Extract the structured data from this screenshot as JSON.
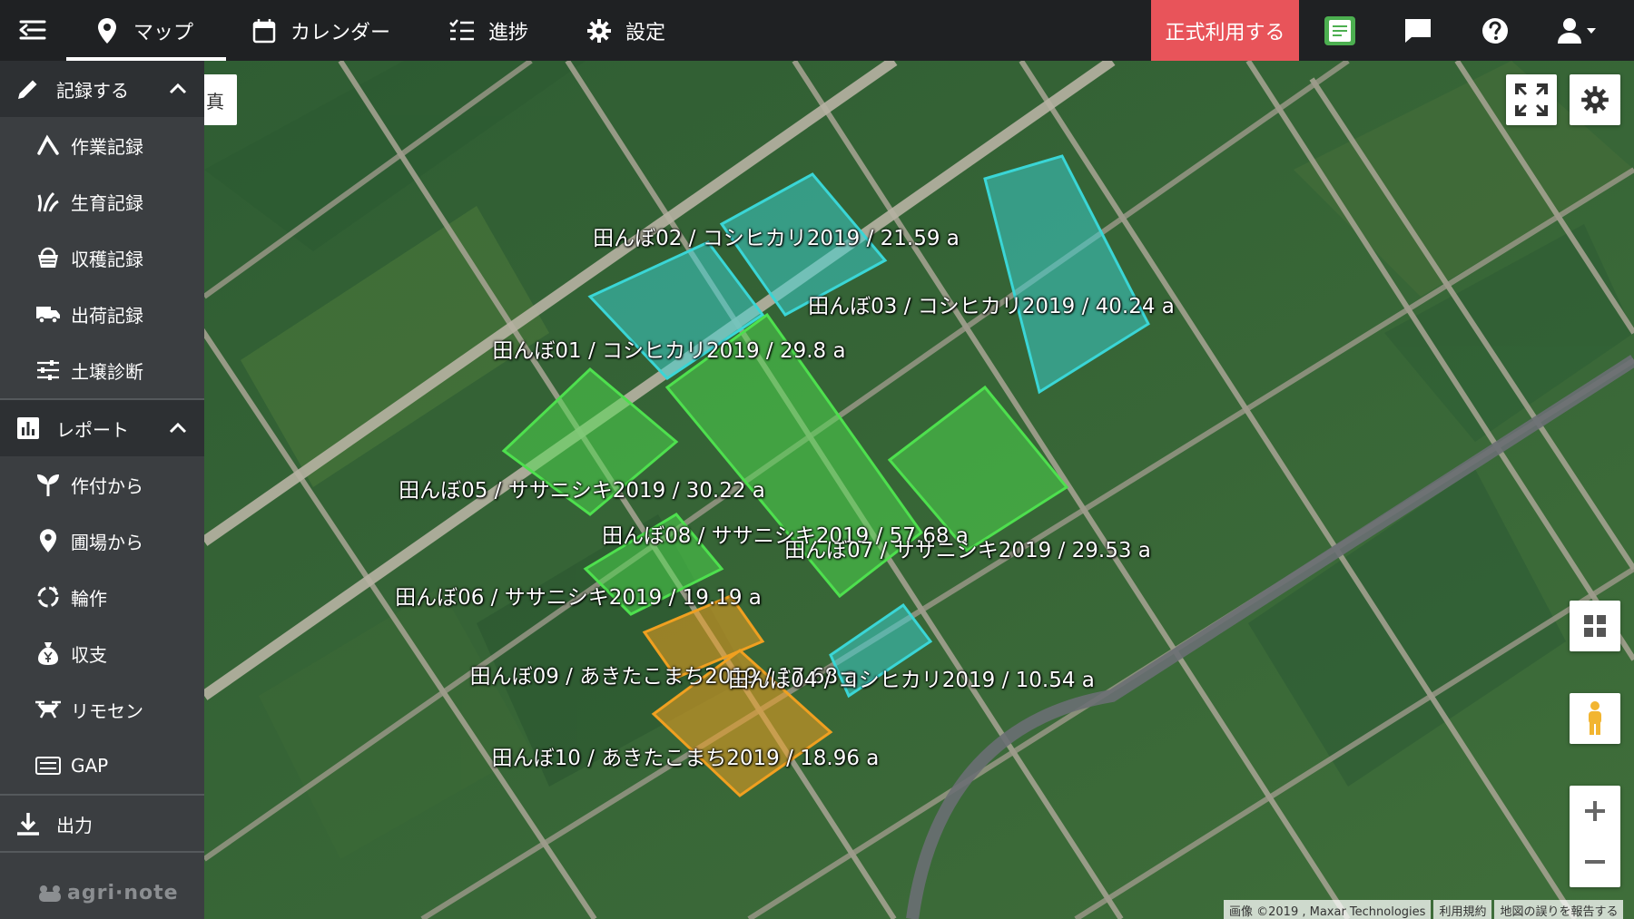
{
  "nav": {
    "tabs": [
      {
        "label": "マップ",
        "icon": "map-pin-icon"
      },
      {
        "label": "カレンダー",
        "icon": "calendar-icon"
      },
      {
        "label": "進捗",
        "icon": "checklist-icon"
      },
      {
        "label": "設定",
        "icon": "gear-icon"
      }
    ],
    "cta_label": "正式利用する",
    "icons": [
      "book-icon",
      "chat-icon",
      "help-icon",
      "user-icon"
    ]
  },
  "sidebar": {
    "record": {
      "title": "記録する",
      "items": [
        {
          "label": "作業記録",
          "icon": "work-record-icon"
        },
        {
          "label": "生育記録",
          "icon": "growth-record-icon"
        },
        {
          "label": "収穫記録",
          "icon": "harvest-basket-icon"
        },
        {
          "label": "出荷記録",
          "icon": "truck-icon"
        },
        {
          "label": "土壌診断",
          "icon": "sliders-icon"
        }
      ]
    },
    "report": {
      "title": "レポート",
      "items": [
        {
          "label": "作付から",
          "icon": "sprout-icon"
        },
        {
          "label": "圃場から",
          "icon": "map-pin-icon"
        },
        {
          "label": "輪作",
          "icon": "rotation-icon"
        },
        {
          "label": "収支",
          "icon": "money-bag-icon"
        },
        {
          "label": "リモセン",
          "icon": "drone-icon"
        },
        {
          "label": "GAP",
          "icon": "gap-icon"
        }
      ]
    },
    "export_label": "出力",
    "brand": "agri·note"
  },
  "map": {
    "search_stub": "真",
    "fields": [
      {
        "label": "田んぼ02  /  コシヒカリ2019  /  21.59 a",
        "color": "#3ad6d6"
      },
      {
        "label": "田んぼ03  /  コシヒカリ2019  /  40.24 a",
        "color": "#3ad6d6"
      },
      {
        "label": "田んぼ01  /  コシヒカリ2019  /  29.8 a",
        "color": "#3ad6d6"
      },
      {
        "label": "田んぼ05  /  ササニシキ2019  /  30.22 a",
        "color": "#4ee04e"
      },
      {
        "label": "田んぼ08  /  ササニシキ2019  /  57.68 a",
        "color": "#4ee04e"
      },
      {
        "label": "田んぼ07  /  ササニシキ2019  /  29.53 a",
        "color": "#4ee04e"
      },
      {
        "label": "田んぼ06  /  ササニシキ2019  /  19.19 a",
        "color": "#4ee04e"
      },
      {
        "label": "田んぼ09  /  あきたこまち2019  /  17.68 a",
        "color": "#f0a020"
      },
      {
        "label": "田んぼ04  /  コシヒカリ2019  /  10.54 a",
        "color": "#3ad6d6"
      },
      {
        "label": "田んぼ10  /  あきたこまち2019  /  18.96 a",
        "color": "#f0a020"
      }
    ],
    "attribution": [
      "画像 ©2019 , Maxar Technologies",
      "利用規約",
      "地図の誤りを報告する"
    ]
  }
}
